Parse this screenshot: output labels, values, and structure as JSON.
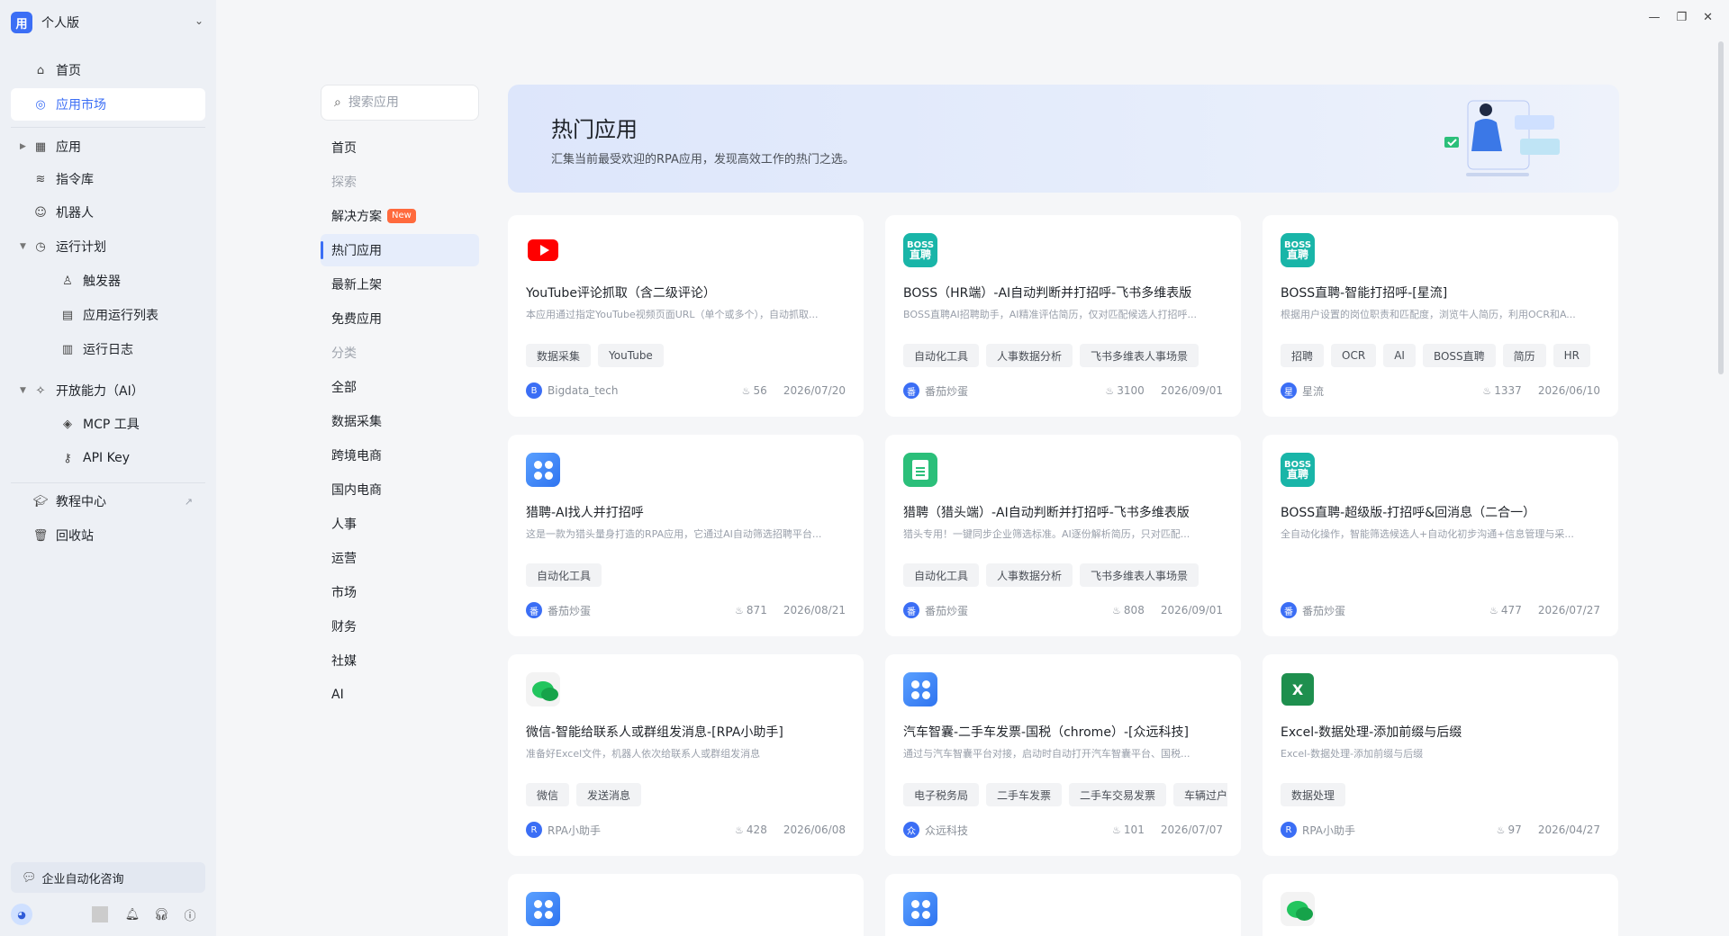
{
  "workspace": {
    "logo": "用",
    "name": "个人版"
  },
  "sidebar": {
    "items": [
      {
        "label": "首页",
        "icon": "home-icon"
      },
      {
        "label": "应用市场",
        "icon": "market-icon"
      },
      {
        "label": "应用",
        "icon": "grid-icon"
      },
      {
        "label": "指令库",
        "icon": "layers-icon"
      },
      {
        "label": "机器人",
        "icon": "robot-icon"
      },
      {
        "label": "运行计划",
        "icon": "clock-icon"
      },
      {
        "label": "触发器",
        "icon": "trigger-icon"
      },
      {
        "label": "应用运行列表",
        "icon": "list-icon"
      },
      {
        "label": "运行日志",
        "icon": "log-icon"
      },
      {
        "label": "开放能力（AI）",
        "icon": "sparkle-icon"
      },
      {
        "label": "MCP 工具",
        "icon": "mcp-icon"
      },
      {
        "label": "API Key",
        "icon": "key-icon"
      },
      {
        "label": "教程中心",
        "icon": "graduation-icon"
      },
      {
        "label": "回收站",
        "icon": "trash-icon"
      }
    ],
    "consult": "企业自动化咨询"
  },
  "search": {
    "placeholder": "搜索应用"
  },
  "categories": [
    "首页",
    "探索",
    "解决方案",
    "热门应用",
    "最新上架",
    "免费应用",
    "分类",
    "全部",
    "数据采集",
    "跨境电商",
    "国内电商",
    "人事",
    "运营",
    "市场",
    "财务",
    "社媒",
    "AI"
  ],
  "new_badge": "New",
  "hero": {
    "title": "热门应用",
    "subtitle": "汇集当前最受欢迎的RPA应用，发现高效工作的热门之选。"
  },
  "cards": [
    {
      "title": "YouTube评论抓取（含二级评论）",
      "desc": "本应用通过指定YouTube视频页面URL（单个或多个），自动抓取...",
      "tags": [
        "数据采集",
        "YouTube"
      ],
      "author": "Bigdata_tech",
      "author_initial": "B",
      "likes": "56",
      "date": "2026/07/20",
      "logo": "youtube"
    },
    {
      "title": "BOSS（HR端）-AI自动判断并打招呼-飞书多维表版",
      "desc": "BOSS直聘AI招聘助手，AI精准评估简历，仅对匹配候选人打招呼...",
      "tags": [
        "自动化工具",
        "人事数据分析",
        "飞书多维表人事场景"
      ],
      "author": "番茄炒蛋",
      "author_initial": "番",
      "likes": "3100",
      "date": "2026/09/01",
      "logo": "boss"
    },
    {
      "title": "BOSS直聘-智能打招呼-[星流]",
      "desc": "根据用户设置的岗位职责和匹配度，浏览牛人简历，利用OCR和A...",
      "tags": [
        "招聘",
        "OCR",
        "AI",
        "BOSS直聘",
        "简历",
        "HR"
      ],
      "author": "星流",
      "author_initial": "星",
      "likes": "1337",
      "date": "2026/06/10",
      "logo": "boss"
    },
    {
      "title": "猎聘-AI找人并打招呼",
      "desc": "这是一款为猎头量身打造的RPA应用，它通过AI自动筛选招聘平台...",
      "tags": [
        "自动化工具"
      ],
      "author": "番茄炒蛋",
      "author_initial": "番",
      "likes": "871",
      "date": "2026/08/21",
      "logo": "blue"
    },
    {
      "title": "猎聘（猎头端）-AI自动判断并打招呼-飞书多维表版",
      "desc": "猎头专用！一键同步企业筛选标准。AI逐份解析简历，只对匹配...",
      "tags": [
        "自动化工具",
        "人事数据分析",
        "飞书多维表人事场景"
      ],
      "author": "番茄炒蛋",
      "author_initial": "番",
      "likes": "808",
      "date": "2026/09/01",
      "logo": "doc"
    },
    {
      "title": "BOSS直聘-超级版-打招呼&回消息（二合一）",
      "desc": "全自动化操作，智能筛选候选人+自动化初步沟通+信息管理与采...",
      "tags": [],
      "author": "番茄炒蛋",
      "author_initial": "番",
      "likes": "477",
      "date": "2026/07/27",
      "logo": "boss"
    },
    {
      "title": "微信-智能给联系人或群组发消息-[RPA小助手]",
      "desc": "准备好Excel文件，机器人依次给联系人或群组发消息",
      "tags": [
        "微信",
        "发送消息"
      ],
      "author": "RPA小助手",
      "author_initial": "R",
      "likes": "428",
      "date": "2026/06/08",
      "logo": "wechat"
    },
    {
      "title": "汽车智囊-二手车发票-国税（chrome）-[众远科技]",
      "desc": "通过与汽车智囊平台对接，启动时自动打开汽车智囊平台、国税...",
      "tags": [
        "电子税务局",
        "二手车发票",
        "二手车交易发票",
        "车辆过户"
      ],
      "author": "众远科技",
      "author_initial": "众",
      "likes": "101",
      "date": "2026/07/07",
      "logo": "blue"
    },
    {
      "title": "Excel-数据处理-添加前缀与后缀",
      "desc": "Excel-数据处理-添加前缀与后缀",
      "tags": [
        "数据处理"
      ],
      "author": "RPA小助手",
      "author_initial": "R",
      "likes": "97",
      "date": "2026/04/27",
      "logo": "excel"
    }
  ],
  "partial_cards": [
    {
      "logo": "blue"
    },
    {
      "logo": "blue"
    },
    {
      "logo": "wechat"
    }
  ],
  "colors": {
    "accent": "#3b6ef5",
    "sidebar_bg": "#edf0f5",
    "page_bg": "#f5f6f8",
    "new_badge": "#ff6a3d"
  }
}
